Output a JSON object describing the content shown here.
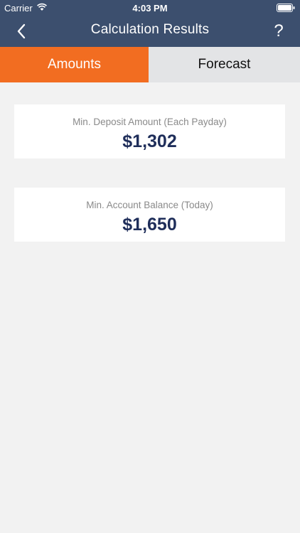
{
  "status_bar": {
    "carrier": "Carrier",
    "time": "4:03 PM"
  },
  "navbar": {
    "title": "Calculation Results",
    "back_icon": "chevron-left-icon",
    "help_label": "?"
  },
  "tabs": [
    {
      "label": "Amounts",
      "active": true
    },
    {
      "label": "Forecast",
      "active": false
    }
  ],
  "cards": [
    {
      "label": "Min. Deposit Amount (Each Payday)",
      "value": "$1,302"
    },
    {
      "label": "Min. Account Balance (Today)",
      "value": "$1,650"
    }
  ],
  "colors": {
    "header": "#3c4f6e",
    "accent": "#f26d21",
    "inactive_tab": "#e3e4e6",
    "value_text": "#1f2e5a",
    "background": "#f2f2f2"
  }
}
